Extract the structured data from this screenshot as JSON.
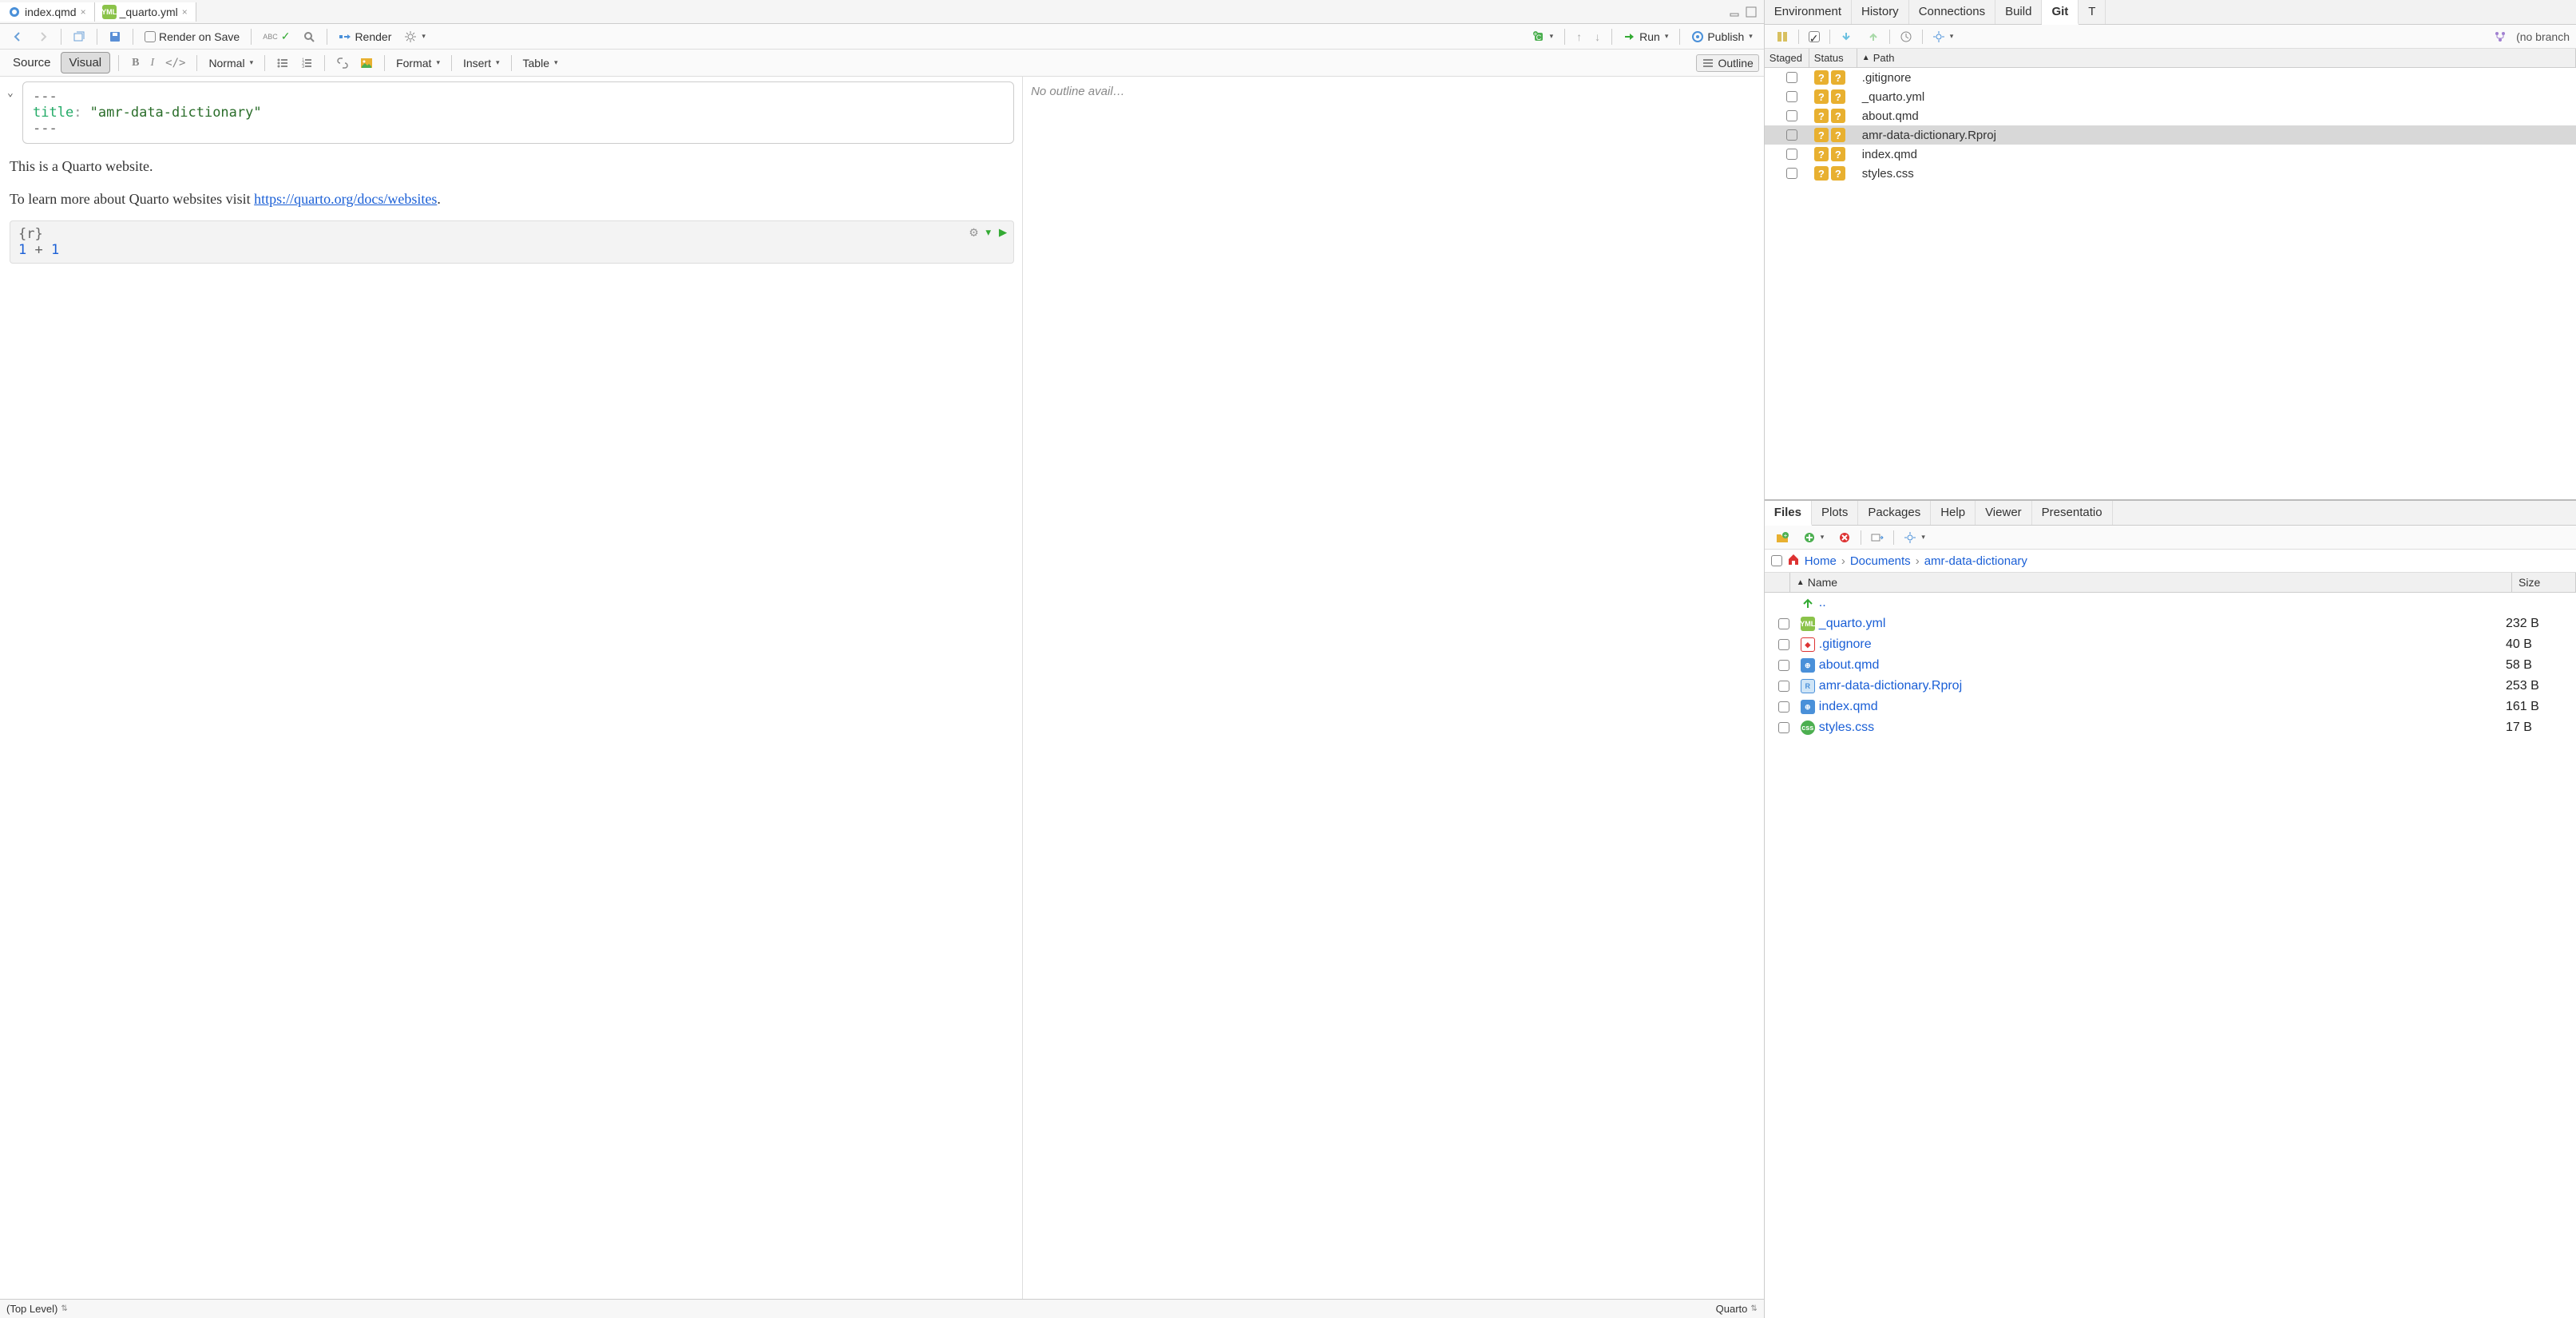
{
  "tabs": [
    {
      "name": "index.qmd",
      "icon": "qmd"
    },
    {
      "name": "_quarto.yml",
      "icon": "yml"
    }
  ],
  "toolbar1": {
    "render_on_save": "Render on Save",
    "render": "Render",
    "run": "Run",
    "publish": "Publish"
  },
  "toolbar2": {
    "source": "Source",
    "visual": "Visual",
    "normal": "Normal",
    "format": "Format",
    "insert": "Insert",
    "table": "Table",
    "outline": "Outline"
  },
  "yaml": {
    "dash1": "---",
    "key": "title",
    "value": "\"amr-data-dictionary\"",
    "dash2": "---"
  },
  "body": {
    "p1": "This is a Quarto website.",
    "p2_pre": "To learn more about Quarto websites visit ",
    "p2_link": "https://quarto.org/docs/websites",
    "p2_post": "."
  },
  "chunk": {
    "lang": "{r}",
    "code_a": "1",
    "code_op": " + ",
    "code_b": "1"
  },
  "outline_msg": "No outline avail…",
  "status": {
    "left": "(Top Level)",
    "right": "Quarto"
  },
  "env_tabs": [
    "Environment",
    "History",
    "Connections",
    "Build",
    "Git",
    "T"
  ],
  "git_toolbar": {
    "no_branch": "(no branch"
  },
  "git_headers": {
    "staged": "Staged",
    "status": "Status",
    "path": "Path"
  },
  "git_rows": [
    {
      "path": ".gitignore",
      "selected": false
    },
    {
      "path": "_quarto.yml",
      "selected": false
    },
    {
      "path": "about.qmd",
      "selected": false
    },
    {
      "path": "amr-data-dictionary.Rproj",
      "selected": true
    },
    {
      "path": "index.qmd",
      "selected": false
    },
    {
      "path": "styles.css",
      "selected": false
    }
  ],
  "files_tabs": [
    "Files",
    "Plots",
    "Packages",
    "Help",
    "Viewer",
    "Presentatio"
  ],
  "breadcrumb": {
    "home": "Home",
    "docs": "Documents",
    "proj": "amr-data-dictionary"
  },
  "files_headers": {
    "name": "Name",
    "size": "Size"
  },
  "files_up": "..",
  "files": [
    {
      "name": "_quarto.yml",
      "size": "232 B",
      "icon": "yml"
    },
    {
      "name": ".gitignore",
      "size": "40 B",
      "icon": "git"
    },
    {
      "name": "about.qmd",
      "size": "58 B",
      "icon": "qmd"
    },
    {
      "name": "amr-data-dictionary.Rproj",
      "size": "253 B",
      "icon": "rproj"
    },
    {
      "name": "index.qmd",
      "size": "161 B",
      "icon": "qmd"
    },
    {
      "name": "styles.css",
      "size": "17 B",
      "icon": "css"
    }
  ]
}
